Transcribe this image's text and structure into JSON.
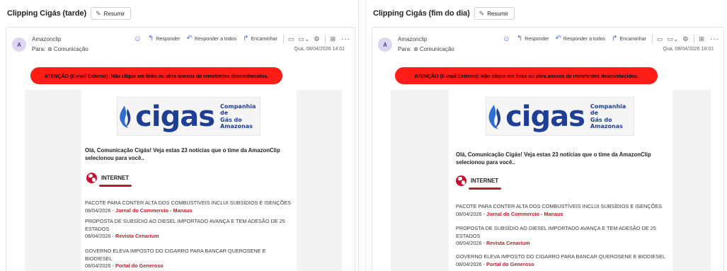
{
  "left": {
    "subject": "Clipping Cigás (tarde)",
    "summarize_label": "Resumir",
    "sender": "Amazonclip",
    "avatar_initial": "A",
    "to_label": "Para:",
    "recipient": "Comunicação",
    "date": "Qua, 08/04/2026 14:01",
    "actions": {
      "reply": "Responder",
      "reply_all": "Responder a todos",
      "forward": "Encaminhar"
    },
    "warning": "ATENÇÃO (E-mail Externo): Não clique em links ou abra anexos de remetentes desconhecidos.",
    "logo_word": "cigas",
    "logo_tagline_1": "Companhia de",
    "logo_tagline_2": "Gás do Amazonas",
    "greeting": "Olá, Comunicação Cigás! Veja estas 23 notícias que o time da AmazonClip selecionou para você..",
    "section": "INTERNET",
    "news": [
      {
        "title": "PACOTE PARA CONTER ALTA DOS COMBUSTÍVEIS INCLUI SUBSÍDIOS E ISENÇÕES",
        "date": "08/04/2026 -",
        "source": "Jornal do Commercio - Manaus"
      },
      {
        "title": "PROPOSTA DE SUBSÍDIO AO DIESEL IMPORTADO AVANÇA E TEM ADESÃO DE 25 ESTADOS",
        "date": "08/04/2026 -",
        "source": "Revista Cenarium"
      },
      {
        "title": "GOVERNO ELEVA IMPOSTO DO CIGARRO PARA BANCAR QUEROSENE E BIODIESEL",
        "date": "08/04/2026 -",
        "source": "Portal do Generoso"
      }
    ]
  },
  "right": {
    "subject": "Clipping Cigás (fim do dia)",
    "summarize_label": "Resumir",
    "sender": "Amazonclip",
    "avatar_initial": "A",
    "to_label": "Para:",
    "recipient": "Comunicação",
    "date": "Qua, 08/04/2026 18:01",
    "actions": {
      "reply": "Responder",
      "reply_all": "Responder a todos",
      "forward": "Encaminhar"
    },
    "warning": "ATENÇÃO (E-mail Externo): Não clique em links ou abra anexos de remetentes desconhecidos.",
    "logo_word": "cigas",
    "logo_tagline_1": "Companhia de",
    "logo_tagline_2": "Gás do Amazonas",
    "greeting": "Olá, Comunicação Cigás! Veja estas 23 notícias que o time da AmazonClip selecionou para você..",
    "section": "INTERNET",
    "news": [
      {
        "title": "PACOTE PARA CONTER ALTA DOS COMBUSTÍVEIS INCLUI SUBSÍDIOS E ISENÇÕES",
        "date": "08/04/2026 -",
        "source": "Jornal do Commercio - Manaus"
      },
      {
        "title": "PROPOSTA DE SUBSÍDIO AO DIESEL IMPORTADO AVANÇA E TEM ADESÃO DE 25 ESTADOS",
        "date": "08/04/2026 -",
        "source": "Revista Cenarium"
      },
      {
        "title": "GOVERNO ELEVA IMPOSTO DO CIGARRO PARA BANCAR QUEROSENE E BIODIESEL",
        "date": "08/04/2026 -",
        "source": "Portal do Generoso"
      }
    ]
  },
  "colors": {
    "warning_bg": "#ff1d16",
    "brand_blue": "#1e3f93",
    "source_red": "#c0202a",
    "action_blue": "#4f6bed"
  },
  "icons": [
    "summarize-icon",
    "emoji-icon",
    "reply-icon",
    "reply-all-icon",
    "forward-icon",
    "more-icon",
    "globe-icon",
    "flame-icon"
  ]
}
